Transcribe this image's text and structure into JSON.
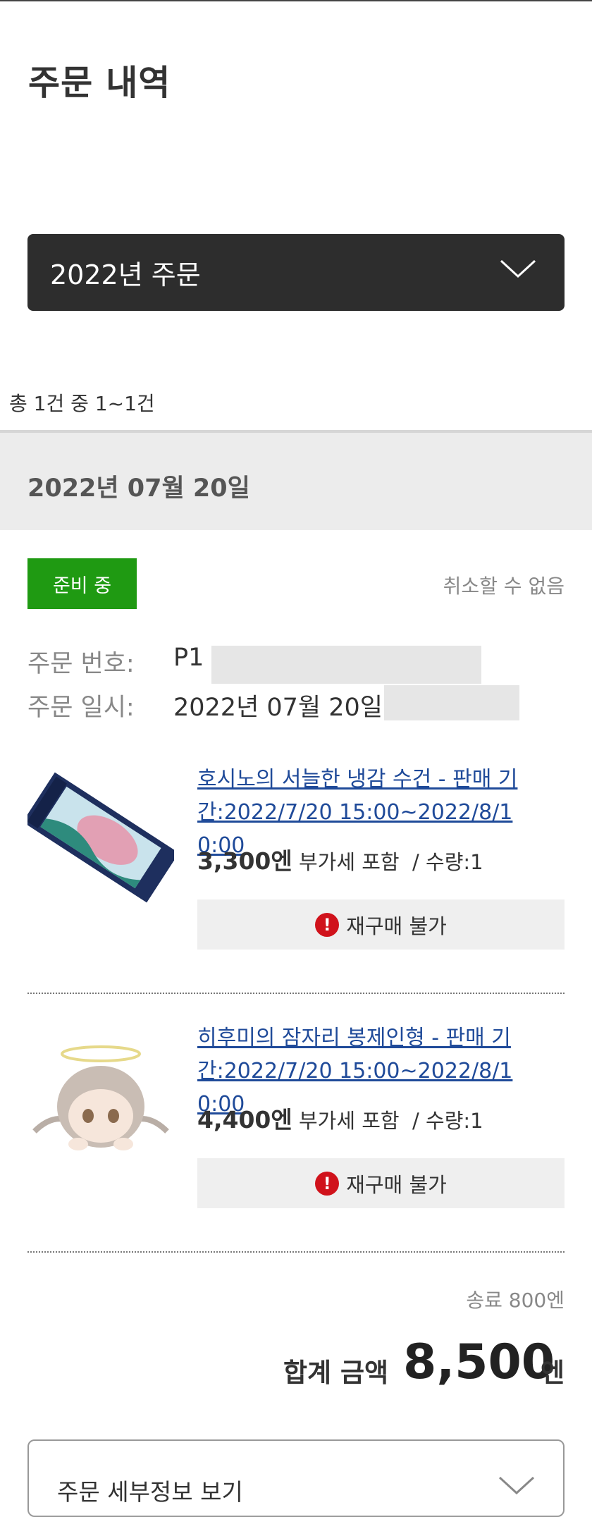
{
  "page": {
    "title": "주문 내역"
  },
  "year_selector": {
    "label": "2022년 주문",
    "icon": "chevron-down-icon"
  },
  "result_count": "총 1건 중 1~1건",
  "order": {
    "date_header": "2022년 07월 20일",
    "status": "준비 중",
    "cancel_note": "취소할 수 없음",
    "number_label": "주문 번호:",
    "number_value": "P1",
    "datetime_label": "주문 일시:",
    "datetime_value": "2022년 07월 20일"
  },
  "items": [
    {
      "title": "호시노의 서늘한 냉감 수건 - 판매 기간:2022/7/20 15:00~2022/8/1 0:00",
      "price": "3,300엔",
      "tax_note": "부가세 포함",
      "qty": "/ 수량:1",
      "rebuy_label": "재구매 불가"
    },
    {
      "title": "히후미의 잠자리 봉제인형 - 판매 기간:2022/7/20 15:00~2022/8/1 0:00",
      "price": "4,400엔",
      "tax_note": "부가세 포함",
      "qty": "/ 수량:1",
      "rebuy_label": "재구매 불가"
    }
  ],
  "summary": {
    "shipping": "송료 800엔",
    "total_label": "합계 금액",
    "total_value": "8,500",
    "total_unit": "엔"
  },
  "details_button": {
    "label": "주문 세부정보 보기"
  },
  "colors": {
    "status_green": "#1f9a12",
    "link_blue": "#1f4a99",
    "warning_red": "#d0121b",
    "dark_select": "#2d2d2d"
  }
}
